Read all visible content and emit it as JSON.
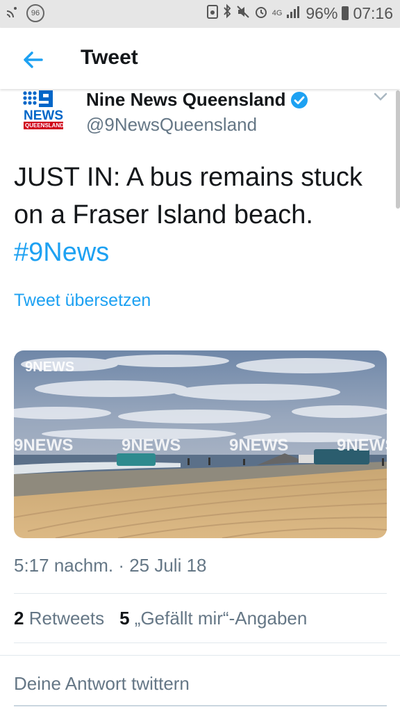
{
  "status_bar": {
    "notification_badge": "96",
    "network": "4G",
    "battery": "96%",
    "time": "07:16",
    "icons": [
      "cast-icon",
      "notification-count-icon",
      "screenshot-icon",
      "bluetooth-icon",
      "mute-icon",
      "alarm-icon",
      "signal-icon",
      "battery-icon"
    ]
  },
  "header": {
    "title": "Tweet",
    "back_icon": "arrow-left-icon"
  },
  "author": {
    "logo_text": "NEWS",
    "logo_sub": "QUEENSLAND",
    "name": "Nine News Queensland",
    "handle": "@9NewsQueensland",
    "verified": true
  },
  "tweet": {
    "text": "JUST IN: A bus remains stuck on a Fraser Island beach.",
    "hashtag": "#9News",
    "translate_label": "Tweet übersetzen",
    "media_watermark": "9NEWS",
    "timestamp": "5:17 nachm. · 25 Juli 18"
  },
  "stats": {
    "retweets_count": "2",
    "retweets_label": "Retweets",
    "likes_count": "5",
    "likes_label": "„Gefällt mir“-Angaben"
  },
  "reply": {
    "placeholder": "Deine Antwort twittern"
  },
  "colors": {
    "accent": "#1da1f2",
    "text": "#14171a",
    "muted": "#657786"
  }
}
